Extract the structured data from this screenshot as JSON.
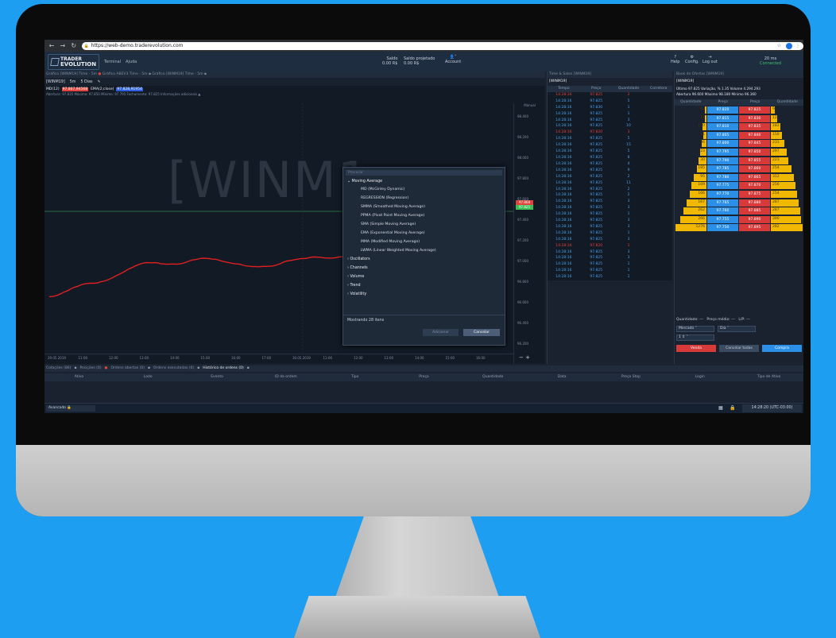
{
  "browser": {
    "url": "https://web-demo.traderevolution.com"
  },
  "app": {
    "logo_line1": "TRADER",
    "logo_line2": "EVOLUTION",
    "menu": [
      "Terminal",
      "Ajuda"
    ],
    "saldo_label": "Saldo",
    "saldo_value": "0.00 R$",
    "saldo_proj_label": "Saldo projetado",
    "saldo_proj_value": "0.00 R$",
    "account_label": "Account",
    "help": "Help",
    "config": "Config.",
    "logout": "Log out",
    "latency": "20 ms",
    "connected": "Connected"
  },
  "chart": {
    "tabs": [
      "Gráfico [WINM19] Time - 5m",
      "Gráfico ABEV3 Time - 5m",
      "Gráfico [WINM19] Time - 5m"
    ],
    "symbol": "[WINM19]",
    "timeframe": "5m",
    "range": "5 Dias",
    "ind1_name": "MD(12)",
    "ind1_val": "97.867,94568",
    "ind2_name": "EMA(2;close)",
    "ind2_val": "97.828,91954",
    "ohlc": "Abertura: 97.835  Máximo: 97.850  Mínimo: 97.795  Fechamento: 97.825  Informações adicionais ▲",
    "watermark": "[WINM1",
    "price_labels": [
      "98.400",
      "98.200",
      "98.000",
      "97.800",
      "97.600",
      "97.400",
      "97.200",
      "97.000",
      "96.800",
      "96.600",
      "96.400",
      "96.200"
    ],
    "last_price": "97.868",
    "last_price2": "97.825",
    "date_labels": [
      "29.05.2019",
      "11:00",
      "12:00",
      "13:00",
      "14:00",
      "15:00",
      "16:00",
      "17:00",
      "30.05.2019",
      "11:00",
      "12:00",
      "13:00",
      "14:00",
      "15:00",
      "16:00"
    ],
    "auto_label": "Manual"
  },
  "popup": {
    "search_placeholder": "Procurar",
    "group": "Moving Average",
    "items": [
      "MD (McGinley Dynamic)",
      "REGRESSION (Regression)",
      "SMMA (Smoothed Moving Average)",
      "PPMA (Pivot Point Moving Average)",
      "SMA (Simple Moving Average)",
      "EMA (Exponential Moving Average)",
      "MMA (Modified Moving Average)",
      "LWMA (Linear Weighted Moving Average)"
    ],
    "categories": [
      "Oscillators",
      "Channels",
      "Volume",
      "Trend",
      "Volatility"
    ],
    "count": "Mostrando 28 itens",
    "add": "Adicionar",
    "cancel": "Cancelar"
  },
  "ts": {
    "title": "Time & Sales [WINM19]",
    "symbol": "[WINM19]",
    "headers": [
      "Tempo",
      "Preço",
      "Quantidade",
      "Corretora"
    ],
    "rows": [
      {
        "t": "14:28:16",
        "p": "97.825",
        "q": "2",
        "s": "r"
      },
      {
        "t": "14:28:16",
        "p": "97.825",
        "q": "5",
        "s": "b"
      },
      {
        "t": "14:28:16",
        "p": "97.830",
        "q": "1",
        "s": "b"
      },
      {
        "t": "14:28:16",
        "p": "97.825",
        "q": "1",
        "s": "b"
      },
      {
        "t": "14:28:16",
        "p": "97.825",
        "q": "3",
        "s": "b"
      },
      {
        "t": "14:28:16",
        "p": "97.825",
        "q": "10",
        "s": "b"
      },
      {
        "t": "14:28:16",
        "p": "97.820",
        "q": "3",
        "s": "r"
      },
      {
        "t": "14:28:16",
        "p": "97.825",
        "q": "5",
        "s": "b"
      },
      {
        "t": "14:28:16",
        "p": "97.825",
        "q": "15",
        "s": "b"
      },
      {
        "t": "14:28:16",
        "p": "97.825",
        "q": "5",
        "s": "b"
      },
      {
        "t": "14:28:16",
        "p": "97.825",
        "q": "8",
        "s": "b"
      },
      {
        "t": "14:28:16",
        "p": "97.825",
        "q": "4",
        "s": "b"
      },
      {
        "t": "14:28:16",
        "p": "97.825",
        "q": "9",
        "s": "b"
      },
      {
        "t": "14:28:16",
        "p": "97.825",
        "q": "2",
        "s": "b"
      },
      {
        "t": "14:28:16",
        "p": "97.825",
        "q": "11",
        "s": "b"
      },
      {
        "t": "14:28:16",
        "p": "97.825",
        "q": "2",
        "s": "b"
      },
      {
        "t": "14:28:16",
        "p": "97.825",
        "q": "2",
        "s": "b"
      },
      {
        "t": "14:28:16",
        "p": "97.825",
        "q": "3",
        "s": "b"
      },
      {
        "t": "14:28:16",
        "p": "97.825",
        "q": "3",
        "s": "b"
      },
      {
        "t": "14:28:16",
        "p": "97.825",
        "q": "1",
        "s": "b"
      },
      {
        "t": "14:28:16",
        "p": "97.825",
        "q": "3",
        "s": "b"
      },
      {
        "t": "14:28:16",
        "p": "97.825",
        "q": "3",
        "s": "b"
      },
      {
        "t": "14:28:16",
        "p": "97.825",
        "q": "1",
        "s": "b"
      },
      {
        "t": "14:28:16",
        "p": "97.825",
        "q": "3",
        "s": "b"
      },
      {
        "t": "14:28:16",
        "p": "97.820",
        "q": "1",
        "s": "r"
      },
      {
        "t": "14:28:16",
        "p": "97.825",
        "q": "3",
        "s": "b"
      },
      {
        "t": "14:28:16",
        "p": "97.825",
        "q": "3",
        "s": "b"
      },
      {
        "t": "14:28:16",
        "p": "97.825",
        "q": "1",
        "s": "b"
      },
      {
        "t": "14:28:16",
        "p": "97.825",
        "q": "1",
        "s": "b"
      },
      {
        "t": "14:28:16",
        "p": "97.825",
        "q": "1",
        "s": "b"
      }
    ]
  },
  "book": {
    "title": "Book de Ofertas [WINM19]",
    "symbol": "[WINM19]",
    "summary1": "Último   97.825 Variação, %  1.35   Volume 4.294.293",
    "summary2": "Abertura  96.600 Máximo    98.180 Mínimo 96.360",
    "headers": [
      "Quantidade",
      "Preço",
      "Preço",
      "Quantidade"
    ],
    "bids": [
      {
        "q": "63",
        "p": "97.820",
        "w": 0.05
      },
      {
        "q": "11",
        "p": "97.815",
        "w": 0.06
      },
      {
        "q": "170",
        "p": "97.810",
        "w": 0.14
      },
      {
        "q": "21",
        "p": "97.805",
        "w": 0.1
      },
      {
        "q": "36",
        "p": "97.800",
        "w": 0.16
      },
      {
        "q": "23",
        "p": "97.795",
        "w": 0.2
      },
      {
        "q": "30",
        "p": "97.790",
        "w": 0.25
      },
      {
        "q": "185",
        "p": "97.785",
        "w": 0.32
      },
      {
        "q": "95",
        "p": "97.780",
        "w": 0.4
      },
      {
        "q": "169",
        "p": "97.775",
        "w": 0.5
      },
      {
        "q": "166",
        "p": "97.770",
        "w": 0.55
      },
      {
        "q": "167",
        "p": "97.765",
        "w": 0.65
      },
      {
        "q": "262",
        "p": "97.760",
        "w": 0.75
      },
      {
        "q": "266",
        "p": "97.755",
        "w": 0.85
      },
      {
        "q": "1276",
        "p": "97.750",
        "w": 1.0
      }
    ],
    "asks": [
      {
        "p": "97.825",
        "q": "9",
        "w": 0.12
      },
      {
        "p": "97.830",
        "q": "12",
        "w": 0.2
      },
      {
        "p": "97.835",
        "q": "183",
        "w": 0.3
      },
      {
        "p": "97.840",
        "q": "150",
        "w": 0.35
      },
      {
        "p": "97.845",
        "q": "231",
        "w": 0.42
      },
      {
        "p": "97.850",
        "q": "297",
        "w": 0.5
      },
      {
        "p": "97.855",
        "q": "223",
        "w": 0.55
      },
      {
        "p": "97.860",
        "q": "254",
        "w": 0.65
      },
      {
        "p": "97.865",
        "q": "312",
        "w": 0.72
      },
      {
        "p": "97.870",
        "q": "256",
        "w": 0.78
      },
      {
        "p": "97.875",
        "q": "254",
        "w": 0.82
      },
      {
        "p": "97.880",
        "q": "287",
        "w": 0.88
      },
      {
        "p": "97.885",
        "q": "287",
        "w": 0.92
      },
      {
        "p": "97.890",
        "q": "390",
        "w": 0.96
      },
      {
        "p": "97.895",
        "q": "282",
        "w": 1.0
      }
    ],
    "qty_label": "Quantidade:",
    "qty_val": "---",
    "avg_label": "Preço médio:",
    "avg_val": "---",
    "lp_label": "L/P:",
    "lp_val": "---",
    "order_type": "Mercado",
    "tif": "Dia",
    "quantity": "1",
    "sell": "Venda",
    "cancel_all": "Cancelar todas",
    "buy": "Compra"
  },
  "bottom": {
    "tabs": [
      "Cotações (86)",
      "Posições (0)",
      "Ordens abertas (0)",
      "Ordens executadas (0)",
      "Histórico de ordens (0)"
    ],
    "headers": [
      "Ativo",
      "Lado",
      "Evento",
      "ID da ordem",
      "Tipo",
      "Preço",
      "Quantidade",
      "Data",
      "Preço Stop",
      "Login",
      "Tipo de Ativo"
    ],
    "mode": "Avancado",
    "clock": "14:28:20 (UTC-03:00)"
  },
  "colors": {
    "bg": "#1d9ef0",
    "accent_red": "#e0433c",
    "accent_blue": "#2b8fe8",
    "ask_bar": "#f0b800"
  }
}
